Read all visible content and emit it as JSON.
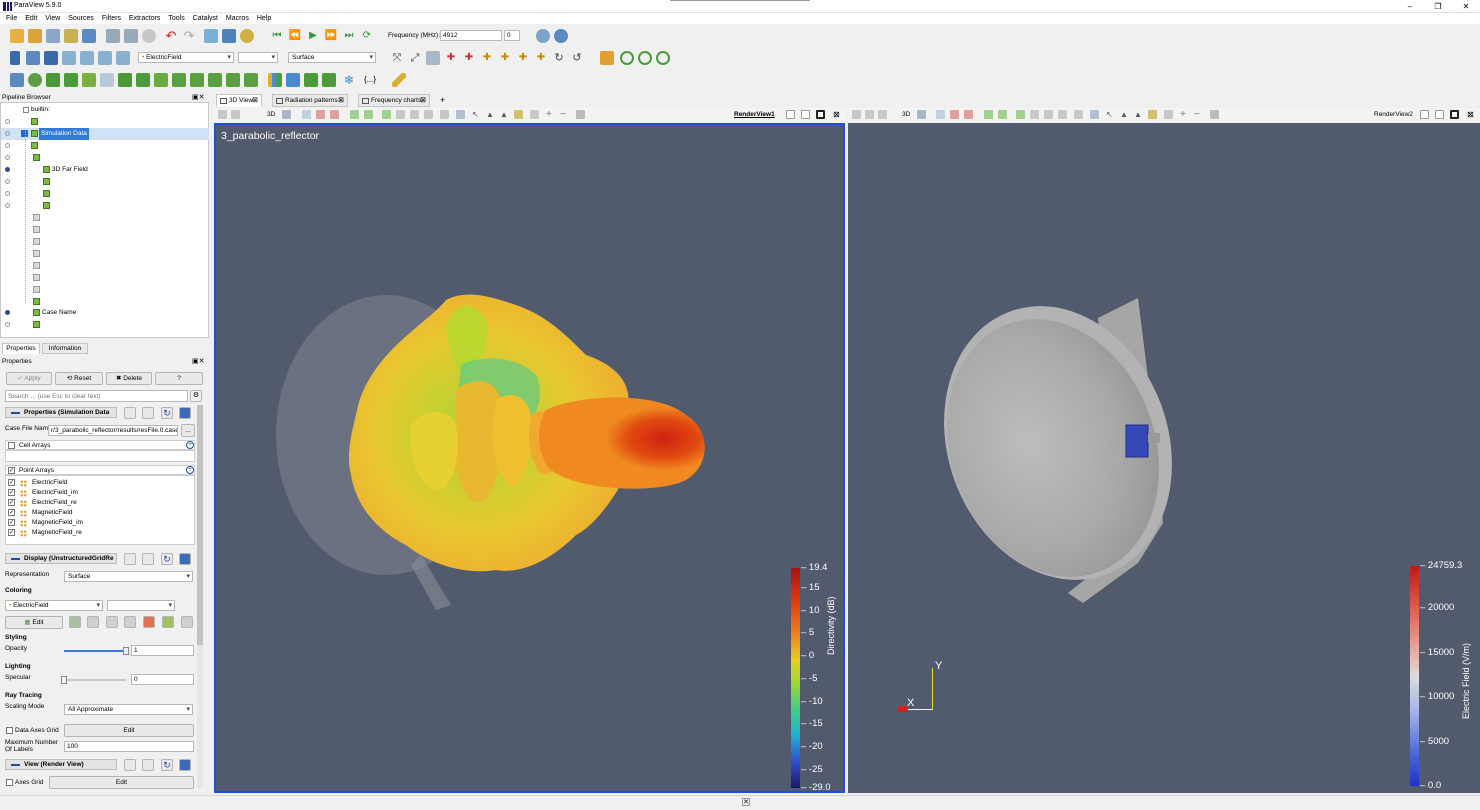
{
  "app": {
    "title": "ParaView 5.9.0",
    "menu": [
      "File",
      "Edit",
      "View",
      "Sources",
      "Filters",
      "Extractors",
      "Tools",
      "Catalyst",
      "Macros",
      "Help"
    ]
  },
  "toolbar": {
    "frequency_label": "Frequency (MHz):",
    "frequency_value": "4912",
    "time_index": "0",
    "array_select": "ElectricField",
    "component_select": "",
    "representation_select": "Surface",
    "axes_button": "{...}"
  },
  "pipeline": {
    "title": "Pipeline Browser",
    "root": "builtin:",
    "simulation_data": "Simulation Data",
    "far_field": "3D Far Field",
    "case_name": "Case Name"
  },
  "panel_tabs": {
    "properties": "Properties",
    "information": "Information"
  },
  "properties": {
    "title": "Properties",
    "apply": "Apply",
    "reset": "Reset",
    "delete": "Delete",
    "help": "?",
    "search_placeholder": "Search ... (use Esc to clear text)",
    "section_props": "Properties (Simulation Data",
    "case_file_label": "Case File Name",
    "case_file_value": "r/3_parabolic_reflector/results/resFile.0.case",
    "case_file_btn": "...",
    "cell_arrays": "Cell Arrays",
    "point_arrays": "Point Arrays",
    "arrays": [
      "ElectricField",
      "ElectricField_im",
      "ElectricField_re",
      "MagneticField",
      "MagneticField_im",
      "MagneticField_re"
    ],
    "section_display": "Display (UnstructuredGridRe",
    "representation_label": "Representation",
    "representation_value": "Surface",
    "coloring_label": "Coloring",
    "coloring_value": "ElectricField",
    "edit": "Edit",
    "styling_label": "Styling",
    "opacity_label": "Opacity",
    "opacity_value": "1",
    "opacity_level": 1.0,
    "lighting_label": "Lighting",
    "specular_label": "Specular",
    "specular_value": "0",
    "specular_level": 0.0,
    "raytracing_label": "Ray Tracing",
    "scaling_label": "Scaling Mode",
    "scaling_value": "All Approximate",
    "data_axes_label": "Data Axes Grid",
    "max_labels_label": "Maximum Number Of Labels",
    "max_labels_value": "100",
    "section_view": "View (Render View)",
    "axes_grid_label": "Axes Grid"
  },
  "tabs": [
    {
      "label": "3D View"
    },
    {
      "label": "Radiation patterns"
    },
    {
      "label": "Frequency charts"
    },
    {
      "label": "+"
    }
  ],
  "view1": {
    "name": "RenderView1",
    "title": "3_parabolic_reflector",
    "toolbar_3d": "3D",
    "colorbar": {
      "title": "Directivity (dB)",
      "max": "19.4",
      "min": "-29.0",
      "ticks": [
        "15",
        "10",
        "5",
        "0",
        "-5",
        "-10",
        "-15",
        "-20",
        "-25"
      ]
    }
  },
  "view2": {
    "name": "RenderView2",
    "toolbar_3d": "3D",
    "axis_y": "Y",
    "axis_x": "X",
    "colorbar": {
      "title": "Electric Field (V/m)",
      "max": "24759.3",
      "min": "0.0",
      "ticks": [
        "20000",
        "15000",
        "10000",
        "5000"
      ]
    }
  },
  "colors": {
    "view_bg": "#525a6e",
    "active_border": "#1e4fd8",
    "accent": "#1e4f9c"
  }
}
